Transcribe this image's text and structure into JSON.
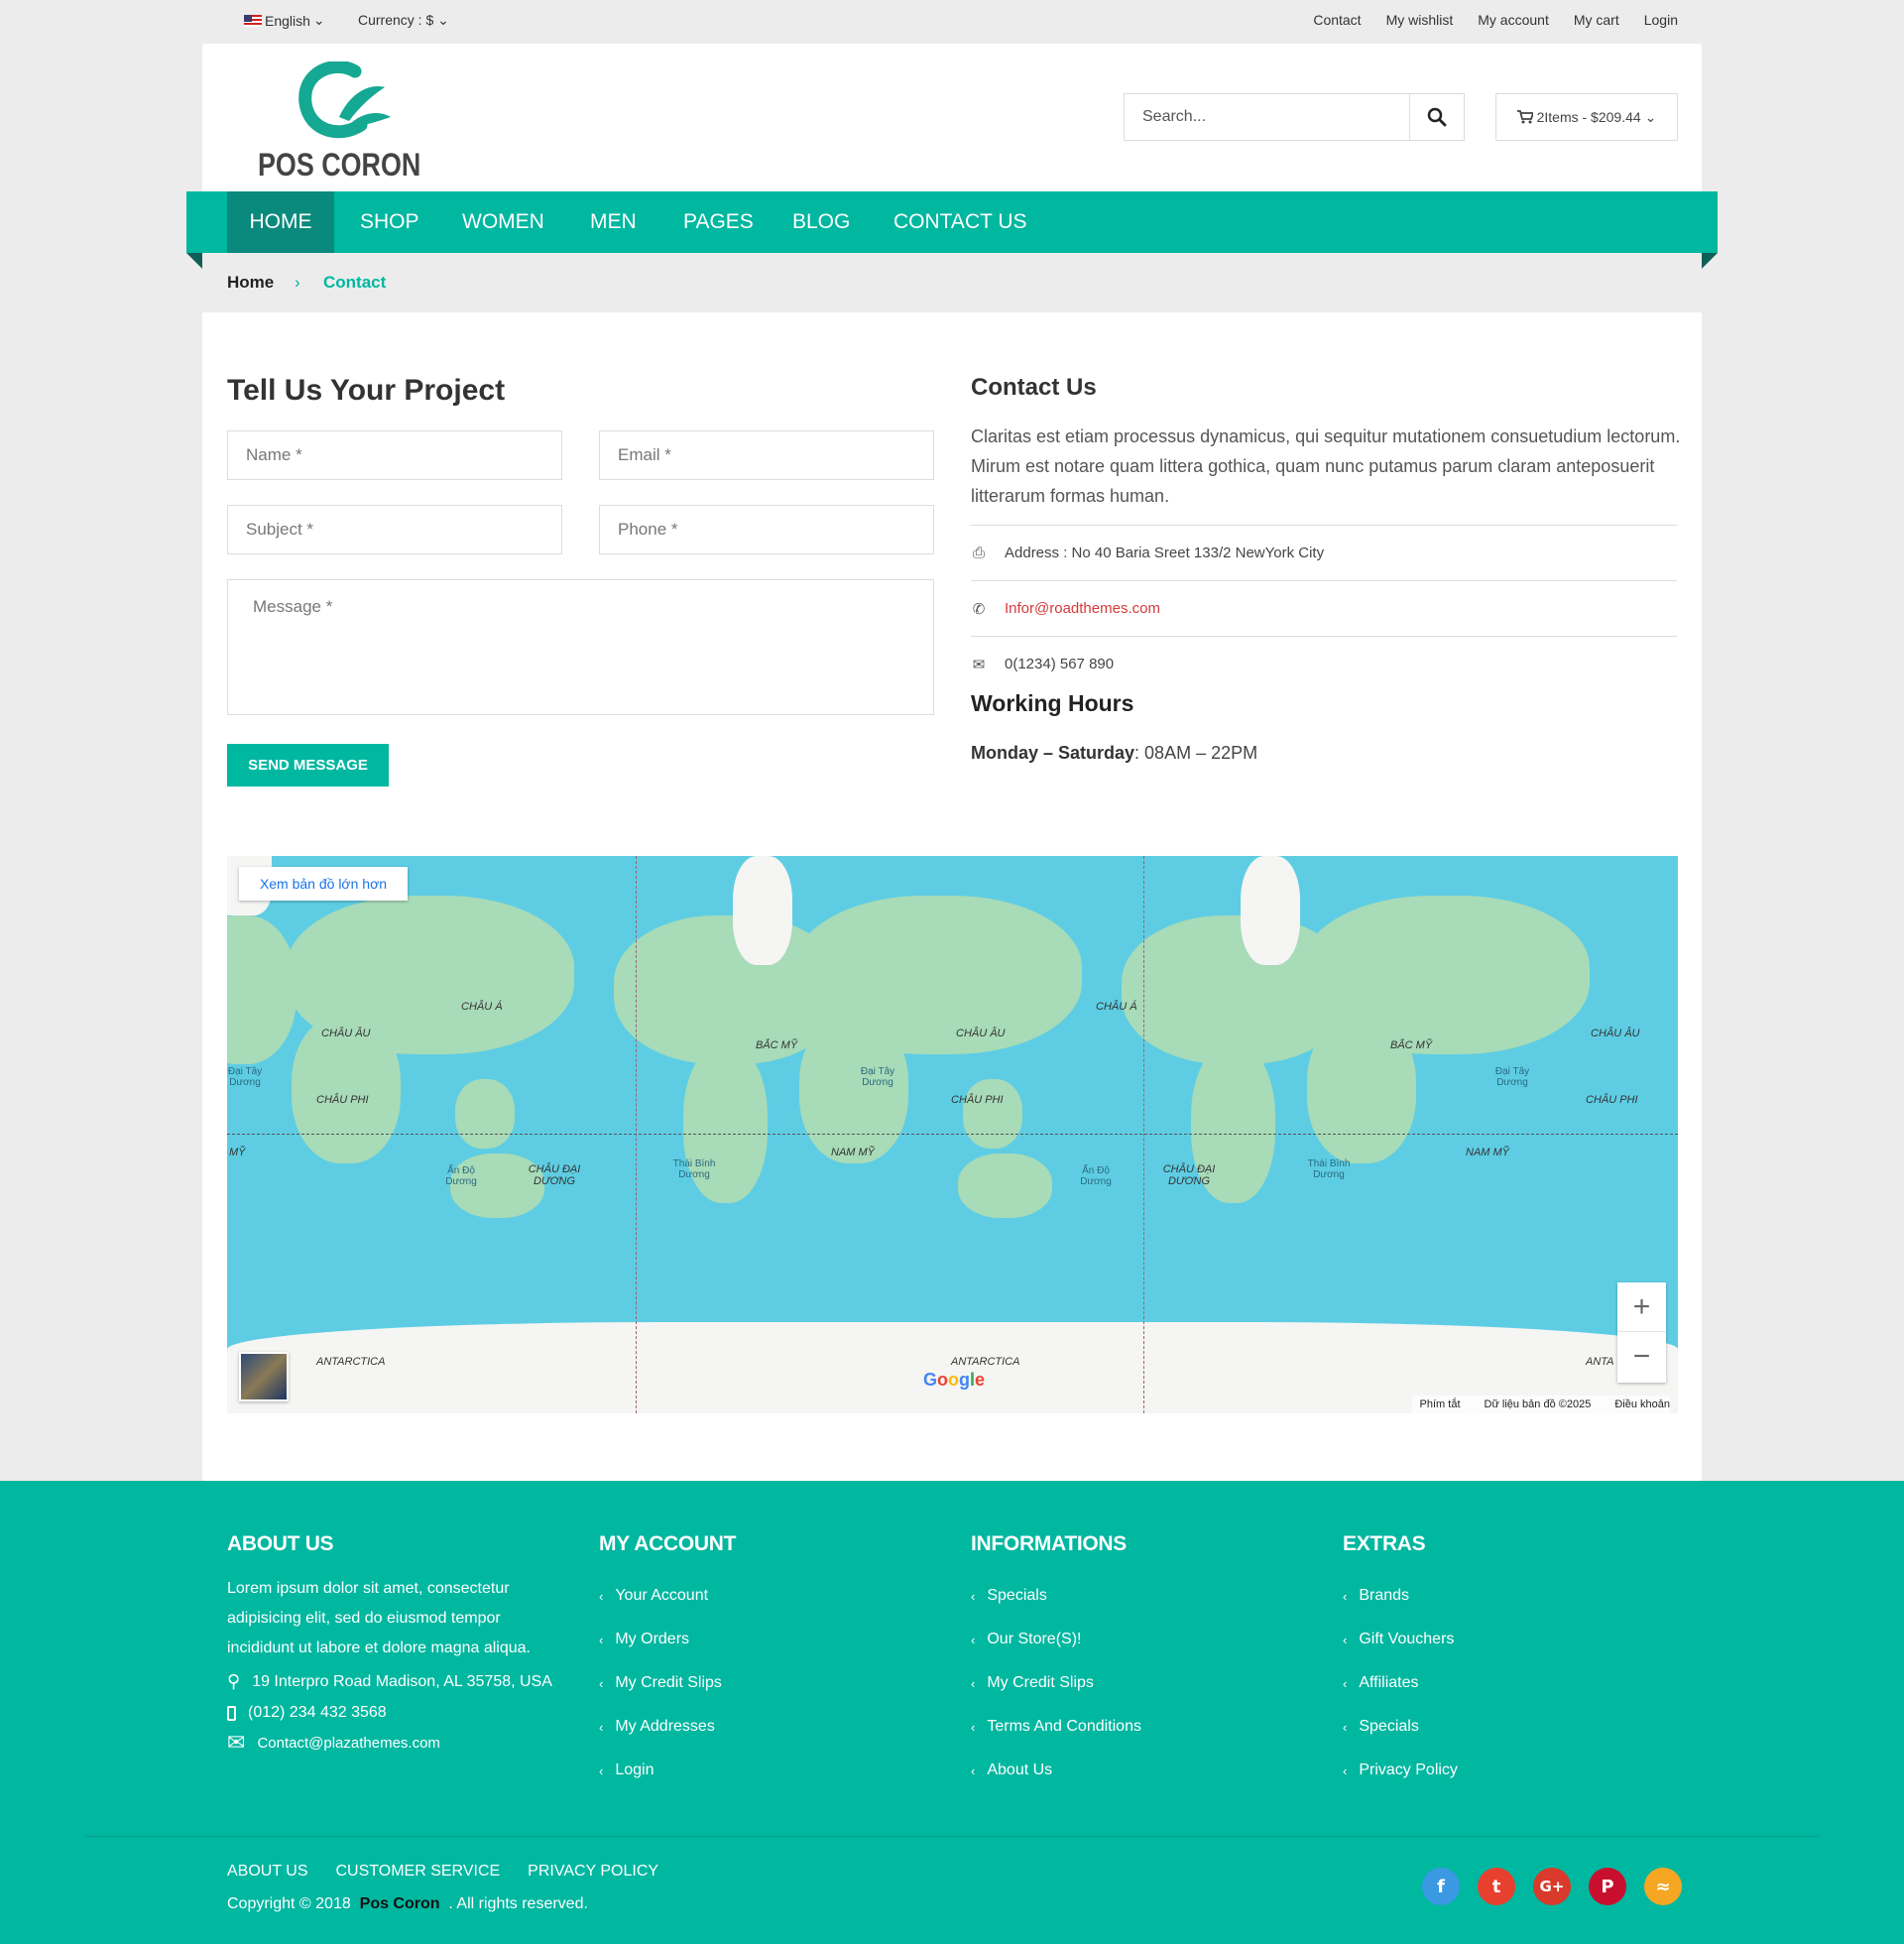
{
  "topbar": {
    "language": "English",
    "currency": "Currency : $",
    "links": [
      "Contact",
      "My wishlist",
      "My account",
      "My cart",
      "Login"
    ]
  },
  "header": {
    "logo_text": "POS CORON",
    "search_placeholder": "Search...",
    "cart_label": "2Items - $209.44"
  },
  "nav": {
    "items": [
      "HOME",
      "SHOP",
      "WOMEN",
      "MEN",
      "PAGES",
      "BLOG",
      "CONTACT US"
    ],
    "active": "HOME"
  },
  "breadcrumb": {
    "home": "Home",
    "separator": "›",
    "current": "Contact"
  },
  "form": {
    "title": "Tell Us Your Project",
    "name_placeholder": "Name *",
    "email_placeholder": "Email *",
    "subject_placeholder": "Subject *",
    "phone_placeholder": "Phone *",
    "message_placeholder": "Message *",
    "submit_label": "SEND MESSAGE"
  },
  "contact": {
    "title": "Contact Us",
    "description": "Claritas est etiam processus dynamicus, qui sequitur mutationem consuetudium lectorum. Mirum est notare quam littera gothica, quam nunc putamus parum claram anteposuerit litterarum formas human.",
    "address": "Address : No 40 Baria Sreet 133/2 NewYork City",
    "email": "Infor@roadthemes.com",
    "phone": "0(1234) 567 890",
    "working_hours_title": "Working Hours",
    "working_days": "Monday – Saturday",
    "working_time": ": 08AM – 22PM"
  },
  "map": {
    "larger_map": "Xem bản đồ lớn hơn",
    "labels": {
      "asia1": "CHÂU Á",
      "europe1": "CHÂU ÂU",
      "africa1": "CHÂU PHI",
      "oceania1": "CHÂU ĐẠI DƯƠNG",
      "namerica": "BẮC MỸ",
      "samerica": "NAM MỸ",
      "asia2": "CHÂU Á",
      "europe2": "CHÂU ÂU",
      "africa2": "CHÂU PHI",
      "oceania2": "CHÂU ĐẠI DƯƠNG",
      "namerica2": "BẮC MỸ",
      "samerica2": "NAM MỸ",
      "europe3": "CHÂU ÂU",
      "africa3": "CHÂU PHI",
      "antarctica1": "ANTARCTICA",
      "antarctica2": "ANTARCTICA",
      "antarctica3": "ANTA",
      "my_left": "MỸ",
      "atlantic1": "Đại Tây Dương",
      "atlantic2": "Đại Tây Dương",
      "atlantic3": "Đại Tây Dương",
      "indian1": "Ấn Độ Dương",
      "indian2": "Ấn Độ Dương",
      "pacific1": "Thái Bình Dương",
      "pacific2": "Thái Bình Dương"
    },
    "google": "Google",
    "zoom_in": "+",
    "zoom_out": "−",
    "shortcuts": "Phím tắt",
    "map_data": "Dữ liệu bản đồ ©2025",
    "terms": "Điều khoản"
  },
  "footer": {
    "about_title": "ABOUT US",
    "about_text": "Lorem ipsum dolor sit amet, consectetur adipisicing elit, sed do eiusmod tempor incididunt ut labore et dolore magna aliqua.",
    "address": "19 Interpro Road Madison, AL 35758, USA",
    "phone": "(012) 234 432 3568",
    "email": "Contact@plazathemes.com",
    "account_title": "MY ACCOUNT",
    "account_links": [
      "Your Account",
      "My Orders",
      "My Credit Slips",
      "My Addresses",
      "Login"
    ],
    "info_title": "INFORMATIONS",
    "info_links": [
      "Specials",
      "Our Store(S)!",
      "My Credit Slips",
      "Terms And Conditions",
      "About Us"
    ],
    "extras_title": "EXTRAS",
    "extras_links": [
      "Brands",
      "Gift Vouchers",
      "Affiliates",
      "Specials",
      "Privacy Policy"
    ],
    "bottom_links": [
      "ABOUT US",
      "CUSTOMER SERVICE",
      "PRIVACY POLICY"
    ],
    "copyright_pre": "Copyright © 2018",
    "brand": "Pos Coron",
    "copyright_post": ". All rights reserved.",
    "social": [
      {
        "name": "facebook",
        "glyph": "f",
        "color": "#3b98e2"
      },
      {
        "name": "twitter",
        "glyph": "t",
        "color": "#e8402e"
      },
      {
        "name": "google-plus",
        "glyph": "G+",
        "color": "#d93a2b"
      },
      {
        "name": "pinterest",
        "glyph": "P",
        "color": "#c8102e"
      },
      {
        "name": "rss",
        "glyph": "≈",
        "color": "#f5a623"
      }
    ]
  },
  "colors": {
    "accent": "#00b7a0",
    "accent_dark": "#0a8a7c",
    "link_red": "#d23b3b"
  }
}
